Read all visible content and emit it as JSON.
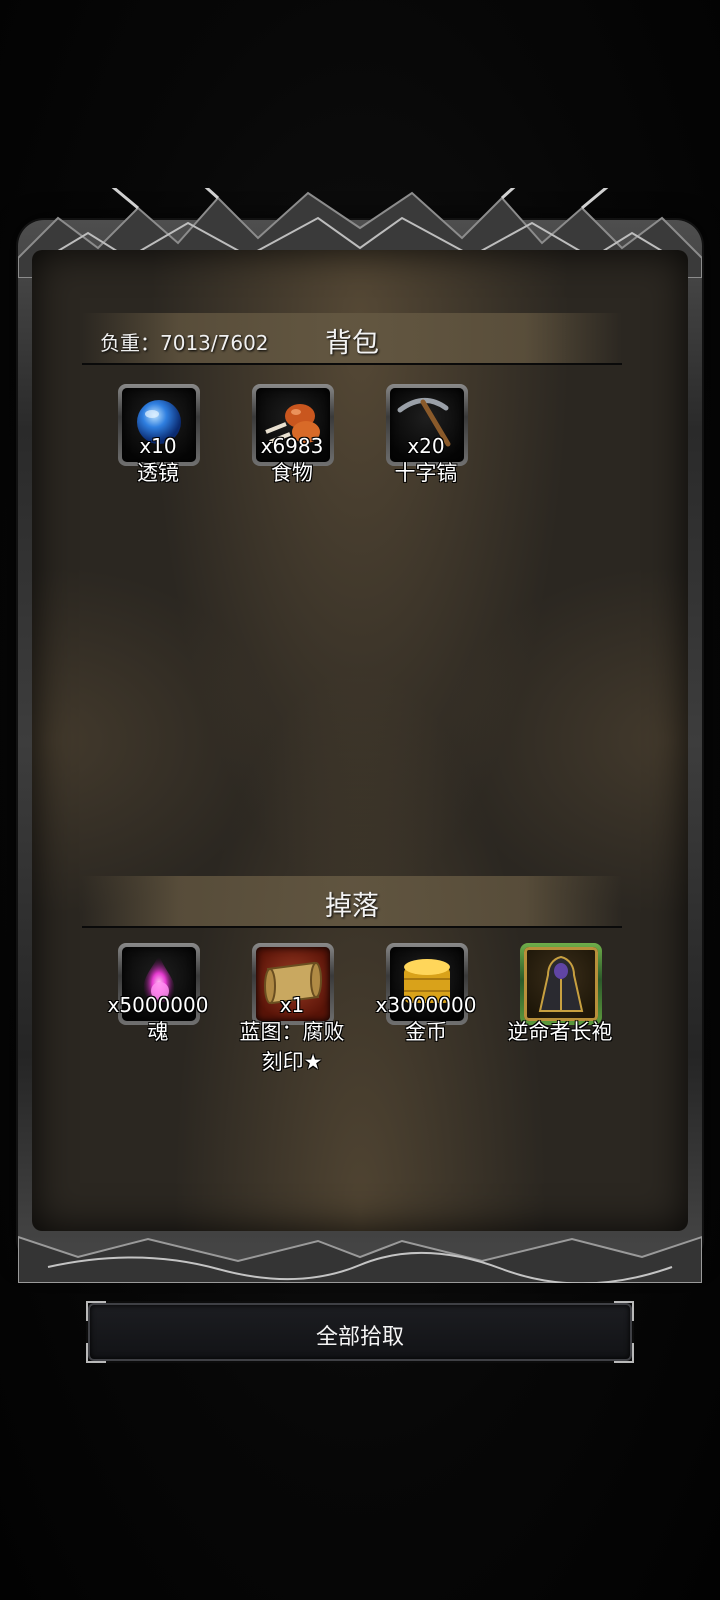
{
  "backpack": {
    "title": "背包",
    "weight_label": "负重：7013/7602",
    "items": [
      {
        "qty": "x10",
        "name": "透镜",
        "icon": "lens-orb-icon"
      },
      {
        "qty": "x6983",
        "name": "食物",
        "icon": "meat-food-icon"
      },
      {
        "qty": "x20",
        "name": "十字镐",
        "icon": "pickaxe-icon"
      }
    ]
  },
  "drops": {
    "title": "掉落",
    "items": [
      {
        "qty": "x5000000",
        "name": "魂",
        "icon": "soul-flame-icon"
      },
      {
        "qty": "x1",
        "name": "蓝图：腐败刻印★",
        "icon": "blueprint-scroll-icon"
      },
      {
        "qty": "x3000000",
        "name": "金币",
        "icon": "gold-coins-icon"
      },
      {
        "qty": "",
        "name": "逆命者长袍",
        "icon": "robe-icon"
      }
    ]
  },
  "actions": {
    "pickup_all": "全部拾取"
  },
  "colors": {
    "panel_bg": "#2b2721",
    "header_band": "#645842",
    "rare_slot_green": "#6fae4a",
    "blueprint_slot_red": "#9a3b24"
  }
}
